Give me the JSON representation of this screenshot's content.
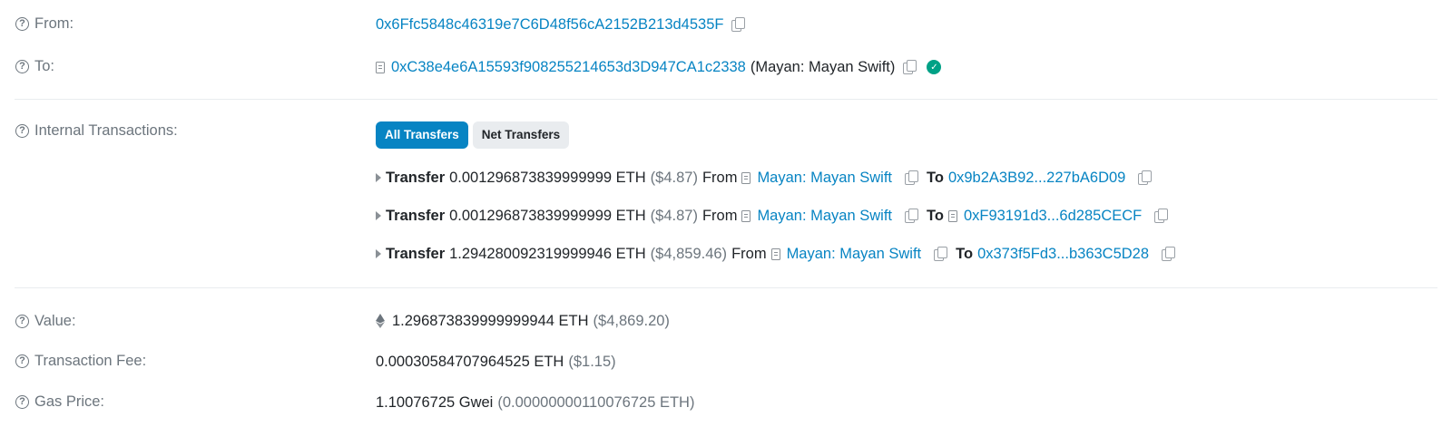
{
  "from": {
    "label": "From:",
    "address": "0x6Ffc5848c46319e7C6D48f56cA2152B213d4535F"
  },
  "to": {
    "label": "To:",
    "address": "0xC38e4e6A15593f908255214653d3D947CA1c2338",
    "name_tag": "(Mayan: Mayan Swift)"
  },
  "internal": {
    "label": "Internal Transactions:",
    "tabs": {
      "all": "All Transfers",
      "net": "Net Transfers"
    },
    "transfers": [
      {
        "word": "Transfer",
        "amount": "0.001296873839999999 ETH",
        "usd": "($4.87)",
        "from_word": "From",
        "from_name": "Mayan: Mayan Swift",
        "to_word": "To",
        "to_addr": "0x9b2A3B92...227bA6D09"
      },
      {
        "word": "Transfer",
        "amount": "0.001296873839999999 ETH",
        "usd": "($4.87)",
        "from_word": "From",
        "from_name": "Mayan: Mayan Swift",
        "to_word": "To",
        "to_addr": "0xF93191d3...6d285CECF"
      },
      {
        "word": "Transfer",
        "amount": "1.294280092319999946 ETH",
        "usd": "($4,859.46)",
        "from_word": "From",
        "from_name": "Mayan: Mayan Swift",
        "to_word": "To",
        "to_addr": "0x373f5Fd3...b363C5D28"
      }
    ]
  },
  "value": {
    "label": "Value:",
    "amount": "1.296873839999999944 ETH",
    "usd": "($4,869.20)"
  },
  "fee": {
    "label": "Transaction Fee:",
    "amount": "0.00030584707964525 ETH",
    "usd": "($1.15)"
  },
  "gas": {
    "label": "Gas Price:",
    "amount": "1.10076725 Gwei",
    "eth": "(0.00000000110076725 ETH)"
  },
  "colors": {
    "link": "#0784c3",
    "primary": "#0784c3",
    "success": "#00a186",
    "muted": "#6c757d"
  }
}
